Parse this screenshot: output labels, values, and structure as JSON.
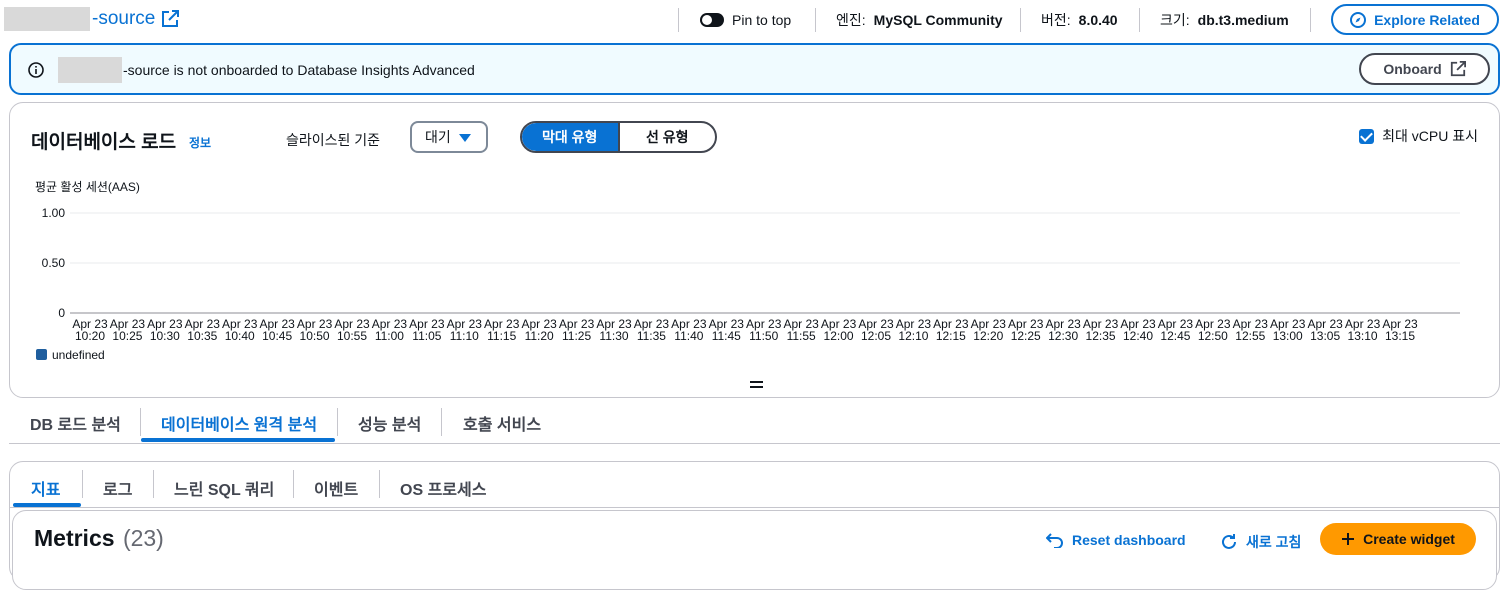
{
  "header": {
    "title_suffix": "-source",
    "pin_label": "Pin to top",
    "engine_label": "엔진:",
    "engine_value": "MySQL Community",
    "version_label": "버전:",
    "version_value": "8.0.40",
    "size_label": "크기:",
    "size_value": "db.t3.medium",
    "explore_button": "Explore Related"
  },
  "banner": {
    "message": "-source is not onboarded to Database Insights Advanced",
    "onboard_button": "Onboard"
  },
  "db_load": {
    "title": "데이터베이스 로드",
    "info_link": "정보",
    "slice_label": "슬라이스된 기준",
    "slice_value": "대기",
    "bar_type": "막대 유형",
    "line_type": "선 유형",
    "vcpu_label": "최대 vCPU 표시"
  },
  "chart_data": {
    "type": "bar",
    "ylabel": "평균 활성 세션(AAS)",
    "ylim": [
      0,
      1.0
    ],
    "yticks": [
      "1.00",
      "0.50",
      "0"
    ],
    "x_date": "Apr 23",
    "categories": [
      "10:20",
      "10:25",
      "10:30",
      "10:35",
      "10:40",
      "10:45",
      "10:50",
      "10:55",
      "11:00",
      "11:05",
      "11:10",
      "11:15",
      "11:20",
      "11:25",
      "11:30",
      "11:35",
      "11:40",
      "11:45",
      "11:50",
      "11:55",
      "12:00",
      "12:05",
      "12:10",
      "12:15",
      "12:20",
      "12:25",
      "12:30",
      "12:35",
      "12:40",
      "12:45",
      "12:50",
      "12:55",
      "13:00",
      "13:05",
      "13:10",
      "13:15"
    ],
    "series": [
      {
        "name": "undefined",
        "values": [
          0,
          0,
          0,
          0,
          0,
          0,
          0,
          0,
          0,
          0,
          0,
          0,
          0,
          0,
          0,
          0,
          0,
          0,
          0,
          0,
          0,
          0,
          0,
          0,
          0,
          0,
          0,
          0,
          0,
          0,
          0,
          0,
          0,
          0,
          0,
          0
        ]
      }
    ],
    "legend_color": "#1f5e9e",
    "grid": true
  },
  "tabs_main": [
    "DB 로드 분석",
    "데이터베이스 원격 분석",
    "성능 분석",
    "호출 서비스"
  ],
  "tabs_sub": [
    "지표",
    "로그",
    "느린 SQL 쿼리",
    "이벤트",
    "OS 프로세스"
  ],
  "metrics": {
    "title": "Metrics",
    "count": "(23)",
    "reset_label": "Reset dashboard",
    "refresh_label": "새로 고침",
    "create_label": "Create widget"
  },
  "colors": {
    "accent": "#0972d3",
    "primary_button": "#ff9900",
    "banner_bg": "#f0fbff"
  }
}
